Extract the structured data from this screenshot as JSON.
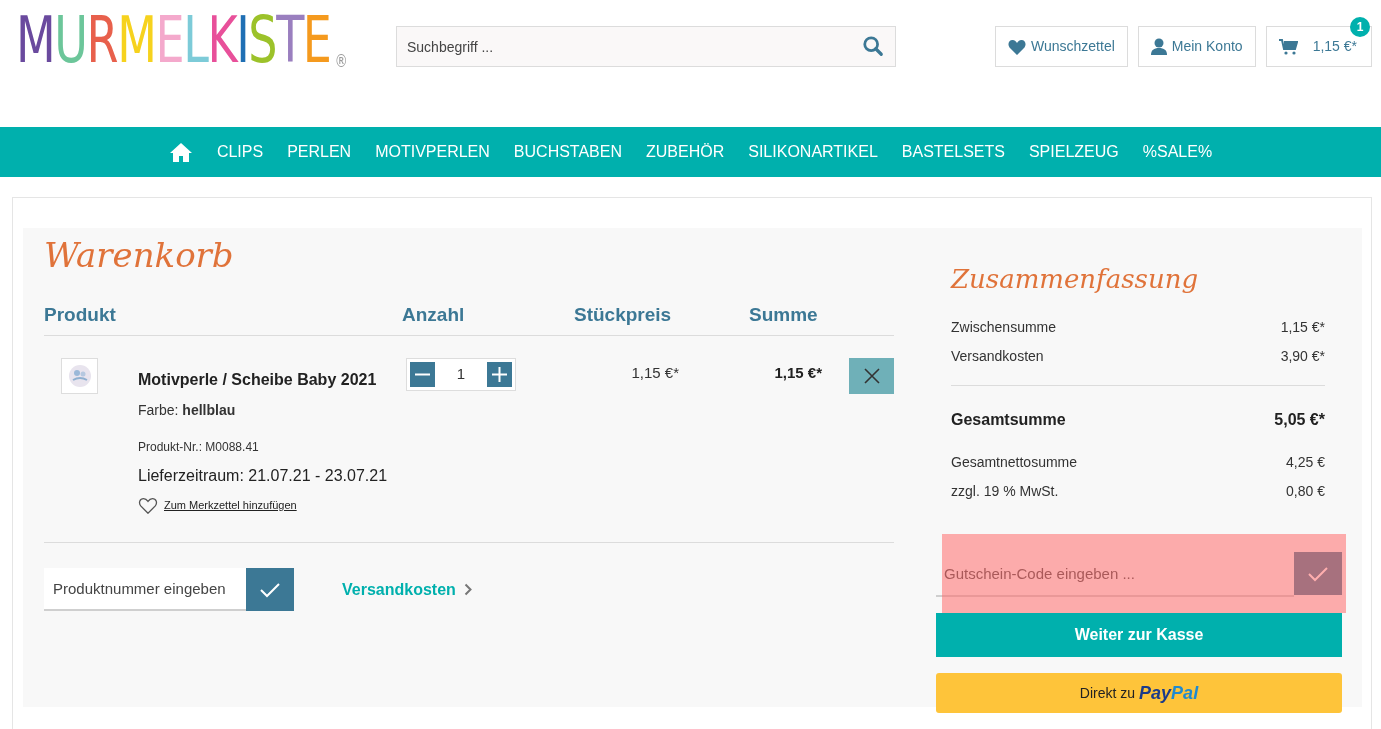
{
  "logo": {
    "letters": [
      {
        "char": "M",
        "color": "#6a4a9e"
      },
      {
        "char": "U",
        "color": "#6cc69a"
      },
      {
        "char": "R",
        "color": "#e8604c"
      },
      {
        "char": "M",
        "color": "#f6d21e"
      },
      {
        "char": "E",
        "color": "#f4a9cc"
      },
      {
        "char": "L",
        "color": "#7dcbd8"
      },
      {
        "char": "K",
        "color": "#e8509a"
      },
      {
        "char": "I",
        "color": "#1f6fb4"
      },
      {
        "char": "S",
        "color": "#9cc22a"
      },
      {
        "char": "T",
        "color": "#9a7fbf"
      },
      {
        "char": "E",
        "color": "#f59a1e"
      }
    ],
    "mark": "®"
  },
  "search": {
    "placeholder": "Suchbegriff ..."
  },
  "header_buttons": [
    {
      "kind": "wishlist",
      "label": "Wunschzettel"
    },
    {
      "kind": "account",
      "label": "Mein Konto"
    },
    {
      "kind": "cart",
      "label": "1,15 €*",
      "badge": "1"
    }
  ],
  "nav": {
    "items": [
      "CLIPS",
      "PERLEN",
      "MOTIVPERLEN",
      "BUCHSTABEN",
      "ZUBEHÖR",
      "SILIKONARTIKEL",
      "BASTELSETS",
      "SPIELZEUG",
      "%SALE%"
    ]
  },
  "cart": {
    "title": "Warenkorb",
    "columns": [
      "Produkt",
      "Anzahl",
      "Stückpreis",
      "Summe"
    ],
    "items": [
      {
        "name": "Motivperle / Scheibe Baby 2021",
        "attribute_label": "Farbe:",
        "attribute_value": "hellblau",
        "number": "Produkt-Nr.: M0088.41",
        "delivery": "Lieferzeitraum: 21.07.21 - 23.07.21",
        "wishlist_link": "Zum Merkzettel hinzufügen",
        "quantity": "1",
        "unit_price": "1,15 €*",
        "total": "1,15 €*"
      }
    ],
    "product_number_field": {
      "placeholder": "Produktnummer eingeben"
    },
    "shipping_link": "Versandkosten"
  },
  "summary": {
    "title": "Zusammenfassung",
    "rows": [
      {
        "kind": "normal",
        "label": "Zwischensumme",
        "value": "1,15 €*"
      },
      {
        "kind": "normal",
        "label": "Versandkosten",
        "value": "3,90 €*"
      },
      {
        "kind": "divider"
      },
      {
        "kind": "total",
        "label": "Gesamtsumme",
        "value": "5,05 €*"
      },
      {
        "kind": "spacer"
      },
      {
        "kind": "normal",
        "label": "Gesamtnettosumme",
        "value": "4,25 €"
      },
      {
        "kind": "normal",
        "label": "zzgl. 19 % MwSt.",
        "value": "0,80 €"
      }
    ],
    "voucher": {
      "placeholder": "Gutschein-Code eingeben ...",
      "highlighted": true
    },
    "checkout_button": "Weiter zur Kasse",
    "paypal": {
      "prefix": "Direkt zu",
      "brand_1": "Pay",
      "brand_2": "Pal"
    }
  }
}
